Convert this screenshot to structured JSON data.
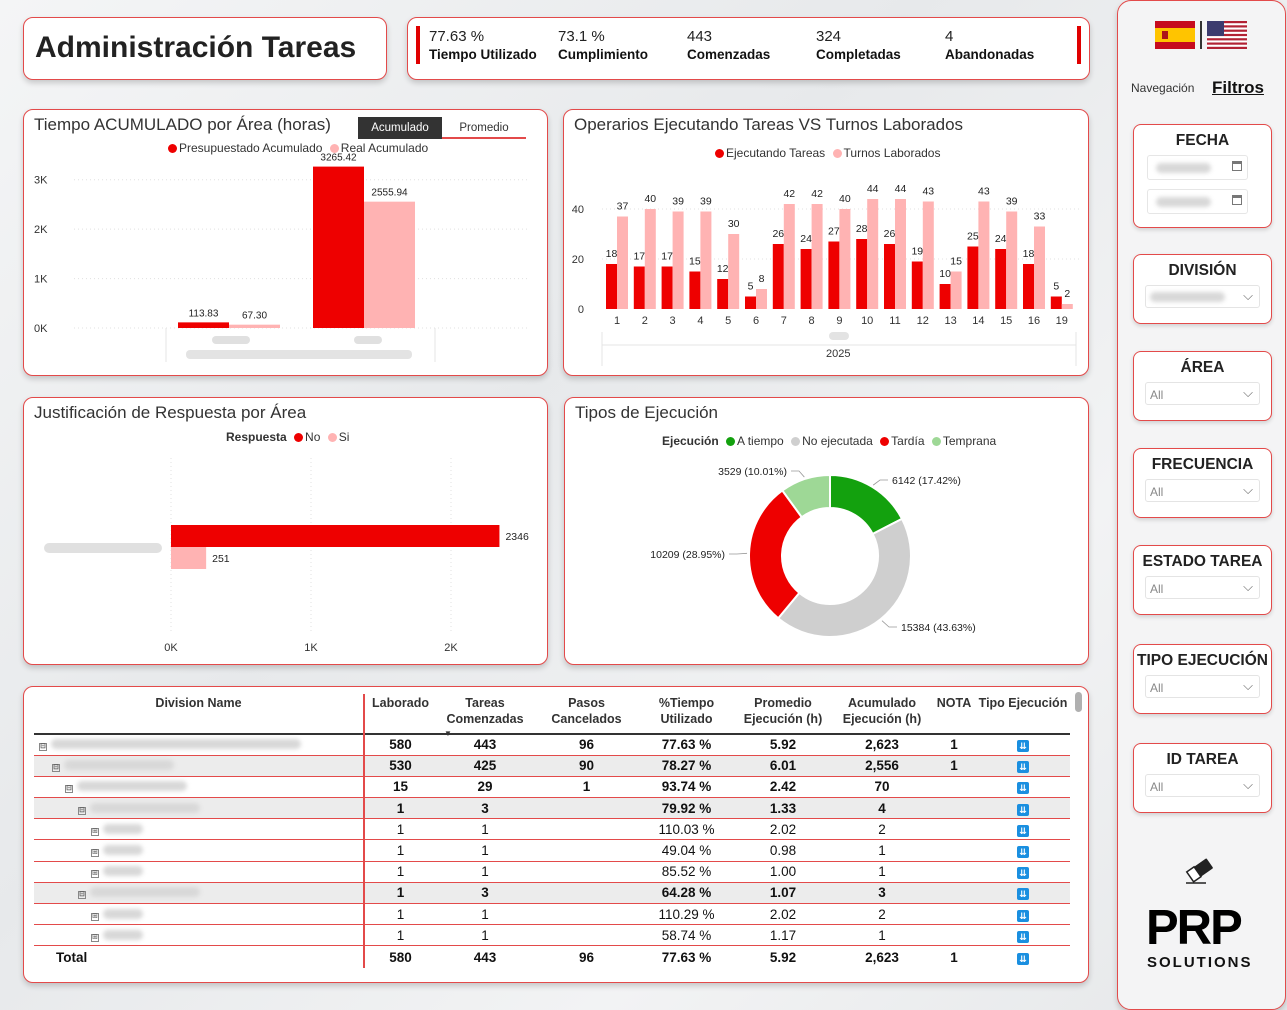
{
  "header": {
    "title": "Administración Tareas"
  },
  "kpis": [
    {
      "value": "77.63 %",
      "label": "Tiempo Utilizado"
    },
    {
      "value": "73.1 %",
      "label": "Cumplimiento"
    },
    {
      "value": "443",
      "label": "Comenzadas"
    },
    {
      "value": "324",
      "label": "Completadas"
    },
    {
      "value": "4",
      "label": "Abandonadas"
    }
  ],
  "panel": {
    "nav_label": "Navegación",
    "filters_label": "Filtros",
    "filters": [
      {
        "title": "FECHA"
      },
      {
        "title": "DIVISIÓN",
        "value": ""
      },
      {
        "title": "ÁREA",
        "value": "All"
      },
      {
        "title": "FRECUENCIA",
        "value": "All"
      },
      {
        "title": "ESTADO TAREA",
        "value": "All"
      },
      {
        "title": "TIPO EJECUCIÓN",
        "value": "All"
      },
      {
        "title": "ID TAREA",
        "value": "All"
      }
    ],
    "logo": {
      "brand": "PRP",
      "sub": "SOLUTIONS"
    },
    "colors": {
      "spain_red": "#c60b1e",
      "spain_yellow": "#ffc400",
      "usa_blue": "#3c3b6e",
      "usa_red": "#b22234"
    }
  },
  "chart1": {
    "title": "Tiempo ACUMULADO por Área (horas)",
    "tabs": [
      "Acumulado",
      "Promedio"
    ],
    "legend": [
      "Presupuestado Acumulado",
      "Real Acumulado"
    ]
  },
  "chart2": {
    "title": "Operarios Ejecutando Tareas VS Turnos Laborados",
    "legend": [
      "Ejecutando Tareas",
      "Turnos Laborados"
    ],
    "year": "2025"
  },
  "chart3": {
    "title": "Justificación de Respuesta por Área",
    "legend_title": "Respuesta",
    "legend": [
      "No",
      "Si"
    ]
  },
  "chart4": {
    "title": "Tipos de Ejecución",
    "legend_title": "Ejecución",
    "legend": [
      "A tiempo",
      "No ejecutada",
      "Tardía",
      "Temprana"
    ]
  },
  "chart_data": [
    {
      "type": "bar",
      "title": "Tiempo ACUMULADO por Área (horas)",
      "categories": [
        "",
        ""
      ],
      "series": [
        {
          "name": "Presupuestado Acumulado",
          "values": [
            113.83,
            3265.42
          ],
          "labels": [
            "113.83",
            "3265.42"
          ],
          "color": "#ee0000"
        },
        {
          "name": "Real Acumulado",
          "values": [
            67.3,
            2555.94
          ],
          "labels": [
            "67.30",
            "2555.94"
          ],
          "color": "#ffb3b3"
        }
      ],
      "yticks": [
        "0K",
        "1K",
        "2K",
        "3K"
      ],
      "ylim": [
        0,
        3500
      ]
    },
    {
      "type": "bar",
      "title": "Operarios Ejecutando Tareas VS Turnos Laborados",
      "categories": [
        "1",
        "2",
        "3",
        "4",
        "5",
        "6",
        "7",
        "8",
        "9",
        "10",
        "11",
        "12",
        "13",
        "14",
        "15",
        "16",
        "19"
      ],
      "series": [
        {
          "name": "Ejecutando Tareas",
          "values": [
            18,
            17,
            17,
            15,
            12,
            5,
            26,
            24,
            27,
            28,
            26,
            19,
            10,
            25,
            24,
            18,
            5
          ],
          "color": "#ee0000"
        },
        {
          "name": "Turnos Laborados",
          "values": [
            37,
            40,
            39,
            39,
            30,
            8,
            42,
            42,
            40,
            44,
            44,
            43,
            15,
            43,
            39,
            33,
            2
          ],
          "color": "#ffb3b3"
        }
      ],
      "yticks": [
        "0",
        "20",
        "40"
      ],
      "ylim": [
        0,
        50
      ]
    },
    {
      "type": "bar",
      "orientation": "horizontal",
      "title": "Justificación de Respuesta por Área",
      "categories": [
        ""
      ],
      "series": [
        {
          "name": "No",
          "values": [
            2346
          ],
          "color": "#ee0000"
        },
        {
          "name": "Si",
          "values": [
            251
          ],
          "color": "#ffb3b3"
        }
      ],
      "xticks": [
        "0K",
        "1K",
        "2K"
      ],
      "xlim": [
        0,
        2500
      ]
    },
    {
      "type": "pie",
      "title": "Tipos de Ejecución",
      "slices": [
        {
          "name": "A tiempo",
          "value": 6142,
          "label": "6142 (17.42%)",
          "color": "#13a10e"
        },
        {
          "name": "No ejecutada",
          "value": 15384,
          "label": "15384 (43.63%)",
          "color": "#cfcfcf"
        },
        {
          "name": "Tardía",
          "value": 10209,
          "label": "10209 (28.95%)",
          "color": "#ee0000"
        },
        {
          "name": "Temprana",
          "value": 3529,
          "label": "3529 (10.01%)",
          "color": "#9ed896"
        }
      ]
    }
  ],
  "table": {
    "headers": [
      "Division Name",
      "Laborado",
      "Tareas Comenzadas",
      "Pasos Cancelados",
      "%Tiempo Utilizado",
      "Promedio Ejecución (h)",
      "Acumulado Ejecución (h)",
      "NOTA",
      "Tipo Ejecución"
    ],
    "rows": [
      {
        "level": 0,
        "exp": "⊟",
        "name": "",
        "bold": true,
        "shade": false,
        "cells": [
          "580",
          "443",
          "96",
          "77.63 %",
          "5.92",
          "2,623",
          "1"
        ]
      },
      {
        "level": 1,
        "exp": "⊟",
        "name": "",
        "bold": true,
        "shade": true,
        "cells": [
          "530",
          "425",
          "90",
          "78.27 %",
          "6.01",
          "2,556",
          "1"
        ]
      },
      {
        "level": 2,
        "exp": "⊟",
        "name": "",
        "bold": true,
        "shade": false,
        "cells": [
          "15",
          "29",
          "1",
          "93.74 %",
          "2.42",
          "70",
          ""
        ]
      },
      {
        "level": 3,
        "exp": "⊟",
        "name": "",
        "bold": true,
        "shade": true,
        "cells": [
          "1",
          "3",
          "",
          "79.92 %",
          "1.33",
          "4",
          ""
        ]
      },
      {
        "level": 4,
        "exp": "⊞",
        "name": "",
        "bold": false,
        "shade": false,
        "cells": [
          "1",
          "1",
          "",
          "110.03 %",
          "2.02",
          "2",
          ""
        ]
      },
      {
        "level": 4,
        "exp": "⊞",
        "name": "",
        "bold": false,
        "shade": false,
        "cells": [
          "1",
          "1",
          "",
          "49.04 %",
          "0.98",
          "1",
          ""
        ]
      },
      {
        "level": 4,
        "exp": "⊞",
        "name": "",
        "bold": false,
        "shade": false,
        "cells": [
          "1",
          "1",
          "",
          "85.52 %",
          "1.00",
          "1",
          ""
        ]
      },
      {
        "level": 3,
        "exp": "⊟",
        "name": "",
        "bold": true,
        "shade": true,
        "cells": [
          "1",
          "3",
          "",
          "64.28 %",
          "1.07",
          "3",
          ""
        ]
      },
      {
        "level": 4,
        "exp": "⊞",
        "name": "",
        "bold": false,
        "shade": false,
        "cells": [
          "1",
          "1",
          "",
          "110.29 %",
          "2.02",
          "2",
          ""
        ]
      },
      {
        "level": 4,
        "exp": "⊞",
        "name": "",
        "bold": false,
        "shade": false,
        "cells": [
          "1",
          "1",
          "",
          "58.74 %",
          "1.17",
          "1",
          ""
        ]
      }
    ],
    "total": {
      "label": "Total",
      "cells": [
        "580",
        "443",
        "96",
        "77.63 %",
        "5.92",
        "2,623",
        "1"
      ]
    }
  }
}
